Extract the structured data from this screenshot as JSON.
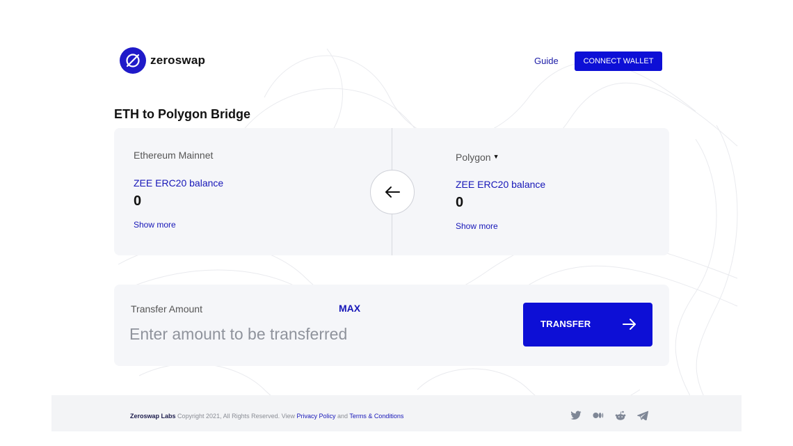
{
  "header": {
    "logo_text": "zeroswap",
    "guide_label": "Guide",
    "connect_label": "CONNECT WALLET"
  },
  "page": {
    "title": "ETH to Polygon Bridge"
  },
  "bridge": {
    "from": {
      "network": "Ethereum Mainnet",
      "balance_label": "ZEE ERC20 balance",
      "balance_value": "0",
      "show_more": "Show more"
    },
    "to": {
      "network": "Polygon",
      "balance_label": "ZEE ERC20 balance",
      "balance_value": "0",
      "show_more": "Show more"
    },
    "swap_icon": "arrow-left-icon"
  },
  "transfer": {
    "label": "Transfer Amount",
    "max_label": "MAX",
    "input_value": "",
    "placeholder": "Enter amount to be transferred",
    "button_label": "TRANSFER",
    "button_icon": "arrow-right-icon"
  },
  "footer": {
    "brand": "Zeroswap Labs",
    "copyright": " Copyright 2021, All Rights Reserved. View ",
    "privacy_label": "Privacy Policy",
    "and": " and ",
    "terms_label": "Terms & Conditions",
    "socials": [
      "twitter-icon",
      "medium-icon",
      "reddit-icon",
      "telegram-icon"
    ]
  },
  "colors": {
    "accent": "#0d0fd6",
    "link": "#1616b8",
    "card_bg": "#f5f6f9",
    "footer_bg": "#f3f4f6"
  }
}
